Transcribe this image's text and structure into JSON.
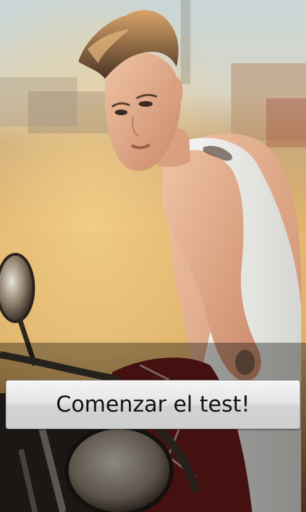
{
  "main": {
    "photo_description": "portrait-photo",
    "start_button_label": "Comenzar el test!"
  },
  "colors": {
    "button_face": "#e6e6e6",
    "button_text": "#111111"
  }
}
